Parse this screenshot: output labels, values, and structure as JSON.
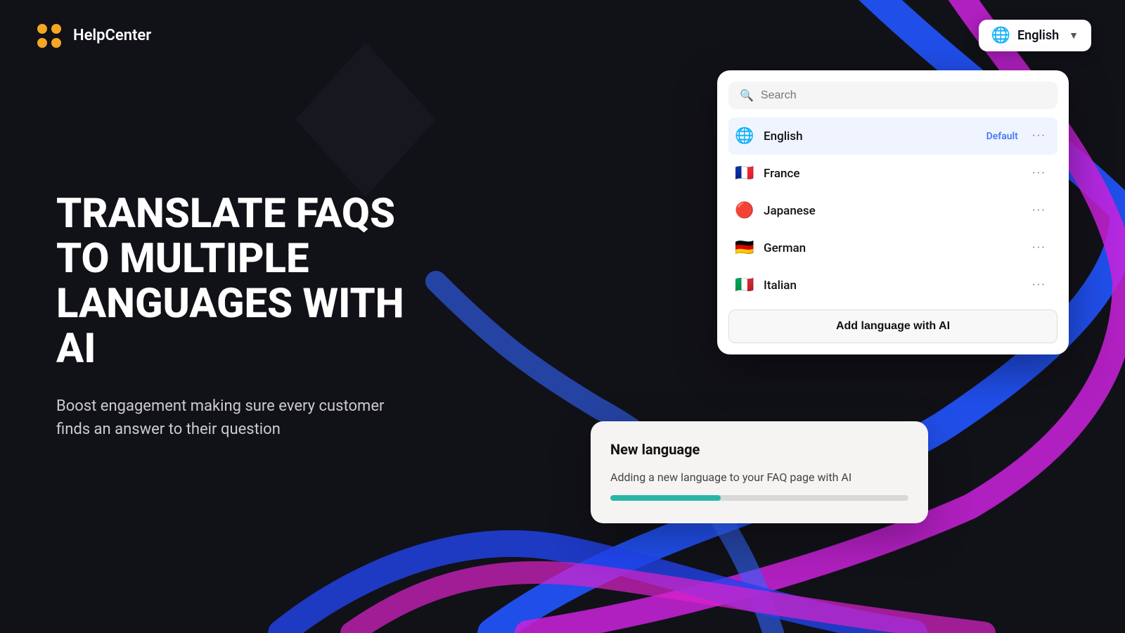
{
  "app": {
    "name": "HelpCenter"
  },
  "language_selector": {
    "label": "English",
    "globe_emoji": "🌐"
  },
  "headline": "Translate FAQs to multiple languages with AI",
  "subheadline": "Boost engagement making sure every customer finds an answer to their question",
  "dropdown": {
    "search_placeholder": "Search",
    "languages": [
      {
        "id": "english",
        "name": "English",
        "flag": "🌐",
        "default": true
      },
      {
        "id": "france",
        "name": "France",
        "flag": "🇫🇷",
        "default": false
      },
      {
        "id": "japanese",
        "name": "Japanese",
        "flag": "🇯🇵",
        "default": false
      },
      {
        "id": "german",
        "name": "German",
        "flag": "🇩🇪",
        "default": false
      },
      {
        "id": "italian",
        "name": "Italian",
        "flag": "🇮🇹",
        "default": false
      }
    ],
    "add_button_label": "Add language with AI",
    "default_label": "Default"
  },
  "progress_card": {
    "title": "New language",
    "description": "Adding a new language to your FAQ page with AI",
    "progress_percent": 37
  }
}
